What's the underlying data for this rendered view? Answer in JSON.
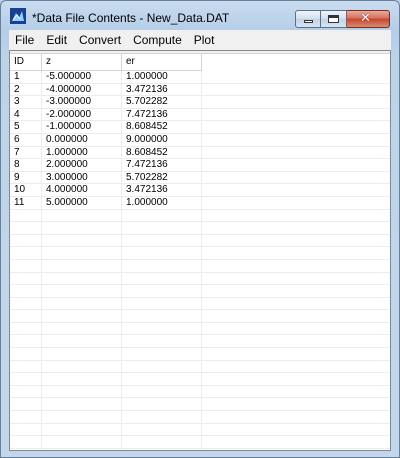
{
  "window": {
    "title": "*Data File Contents - New_Data.DAT",
    "icon": "app-icon"
  },
  "menu": [
    "File",
    "Edit",
    "Convert",
    "Compute",
    "Plot"
  ],
  "table": {
    "columns": [
      "ID",
      "z",
      "er"
    ],
    "rows": [
      [
        "1",
        "-5.000000",
        "1.000000"
      ],
      [
        "2",
        "-4.000000",
        "3.472136"
      ],
      [
        "3",
        "-3.000000",
        "5.702282"
      ],
      [
        "4",
        "-2.000000",
        "7.472136"
      ],
      [
        "5",
        "-1.000000",
        "8.608452"
      ],
      [
        "6",
        "0.000000",
        "9.000000"
      ],
      [
        "7",
        "1.000000",
        "8.608452"
      ],
      [
        "8",
        "2.000000",
        "7.472136"
      ],
      [
        "9",
        "3.000000",
        "5.702282"
      ],
      [
        "10",
        "4.000000",
        "3.472136"
      ],
      [
        "11",
        "5.000000",
        "1.000000"
      ]
    ]
  },
  "colors": {
    "frame": "#b9d1ea",
    "close_button": "#c4462c",
    "grid_line": "#ececec"
  }
}
